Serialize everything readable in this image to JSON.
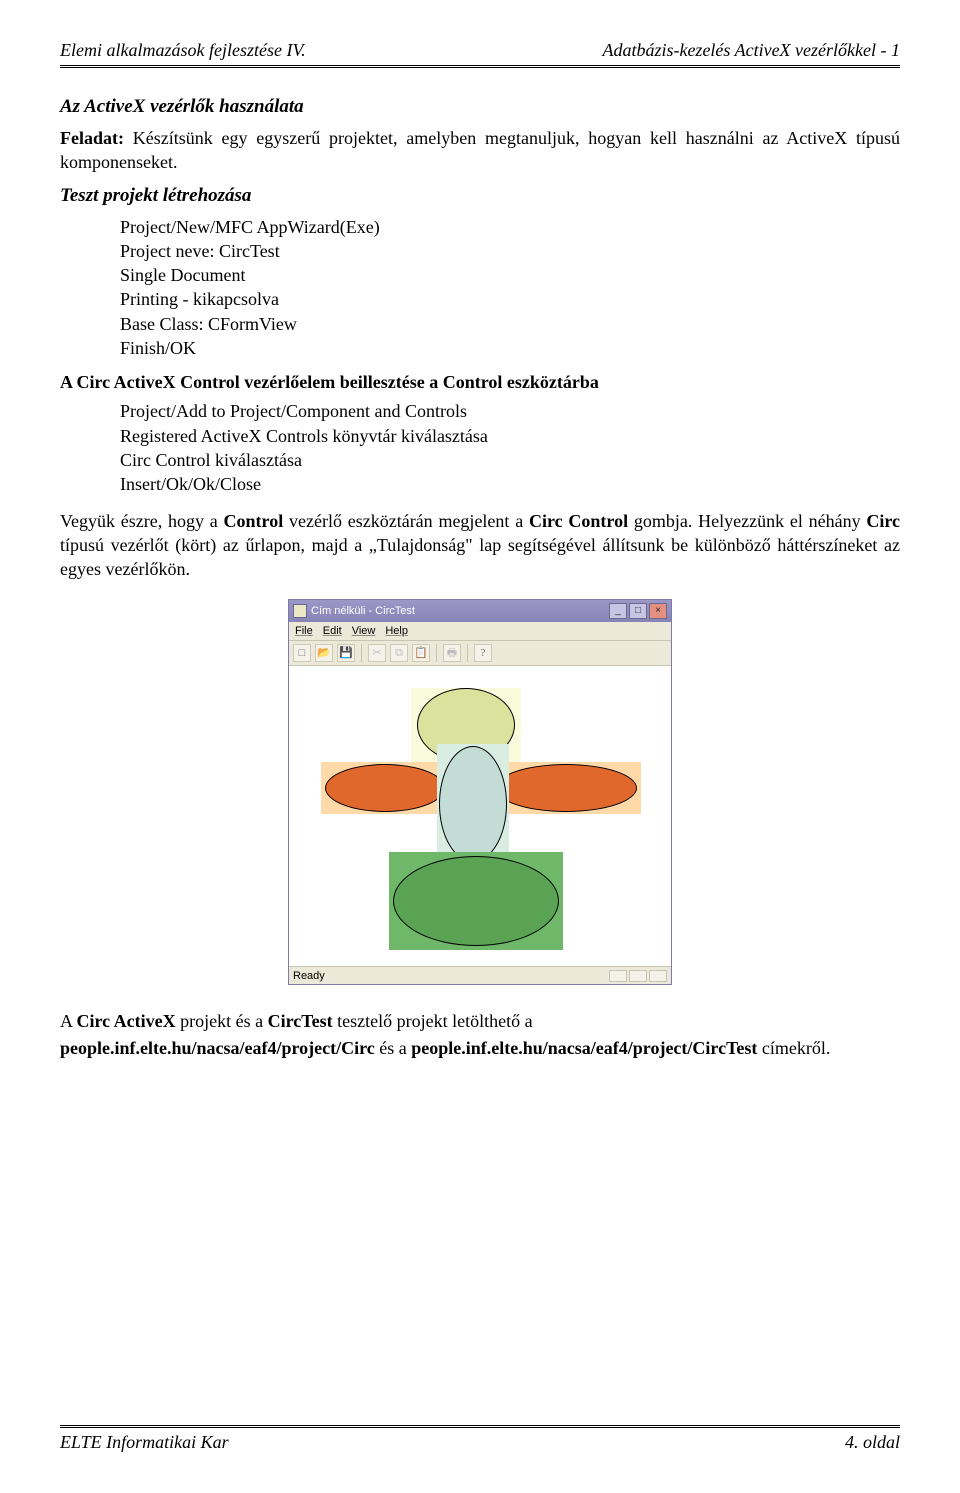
{
  "header": {
    "left": "Elemi alkalmazások fejlesztése IV.",
    "right": "Adatbázis-kezelés ActiveX vezérlőkkel - 1"
  },
  "footer": {
    "left": "ELTE Informatikai Kar",
    "right": "4. oldal"
  },
  "h1": "Az ActiveX vezérlők használata",
  "p1_a": "Feladat:",
  "p1_b": " Készítsünk egy egyszerű projektet, amelyben megtanuljuk, hogyan kell használni az ActiveX típusú komponenseket.",
  "h2": "Teszt projekt létrehozása",
  "blk1_l1": "Project/New/MFC AppWizard(Exe)",
  "blk1_l2": "Project neve: CircTest",
  "blk1_l3": "Single Document",
  "blk1_l4": "Printing - kikapcsolva",
  "blk1_l5": "Base Class: CFormView",
  "blk1_l6": "Finish/OK",
  "h3": "A Circ ActiveX Control vezérlőelem beillesztése a Control eszköztárba",
  "blk2_l1": "Project/Add to Project/Component and Controls",
  "blk2_l2": "Registered ActiveX Controls könyvtár kiválasztása",
  "blk2_l3": "Circ Control kiválasztása",
  "blk2_l4": "Insert/Ok/Ok/Close",
  "p2_a": "Vegyük észre, hogy a ",
  "p2_b": "Control",
  "p2_c": " vezérlő eszköztárán megjelent a ",
  "p2_d": "Circ Control",
  "p2_e": " gombja. Helyezzünk el néhány ",
  "p2_f": "Circ",
  "p2_g": " típusú vezérlőt (kört) az űrlapon, majd a „Tulajdonság\" lap segítségével állítsunk be különböző háttérszíneket az egyes vezérlőkön.",
  "p3_a": "A ",
  "p3_b": "Circ ActiveX",
  "p3_c": " projekt és a ",
  "p3_d": "CircTest",
  "p3_e": " tesztelő projekt letölthető a",
  "p4_a": "people.inf.elte.hu/nacsa/eaf4/project/Circ",
  "p4_b": " és a ",
  "p4_c": "people.inf.elte.hu/nacsa/eaf4/project/CircTest",
  "p4_d": " címekről.",
  "win": {
    "title": "Cím nélküli - CircTest",
    "menus": [
      "File",
      "Edit",
      "View",
      "Help"
    ],
    "status": "Ready",
    "btn_min": "_",
    "btn_max": "□",
    "btn_close": "×",
    "tool_new": "□",
    "tool_open": "📂",
    "tool_save": "💾",
    "tool_cut": "✂",
    "tool_copy": "⧉",
    "tool_paste": "📋",
    "tool_print": "🖶",
    "tool_help": "?"
  }
}
